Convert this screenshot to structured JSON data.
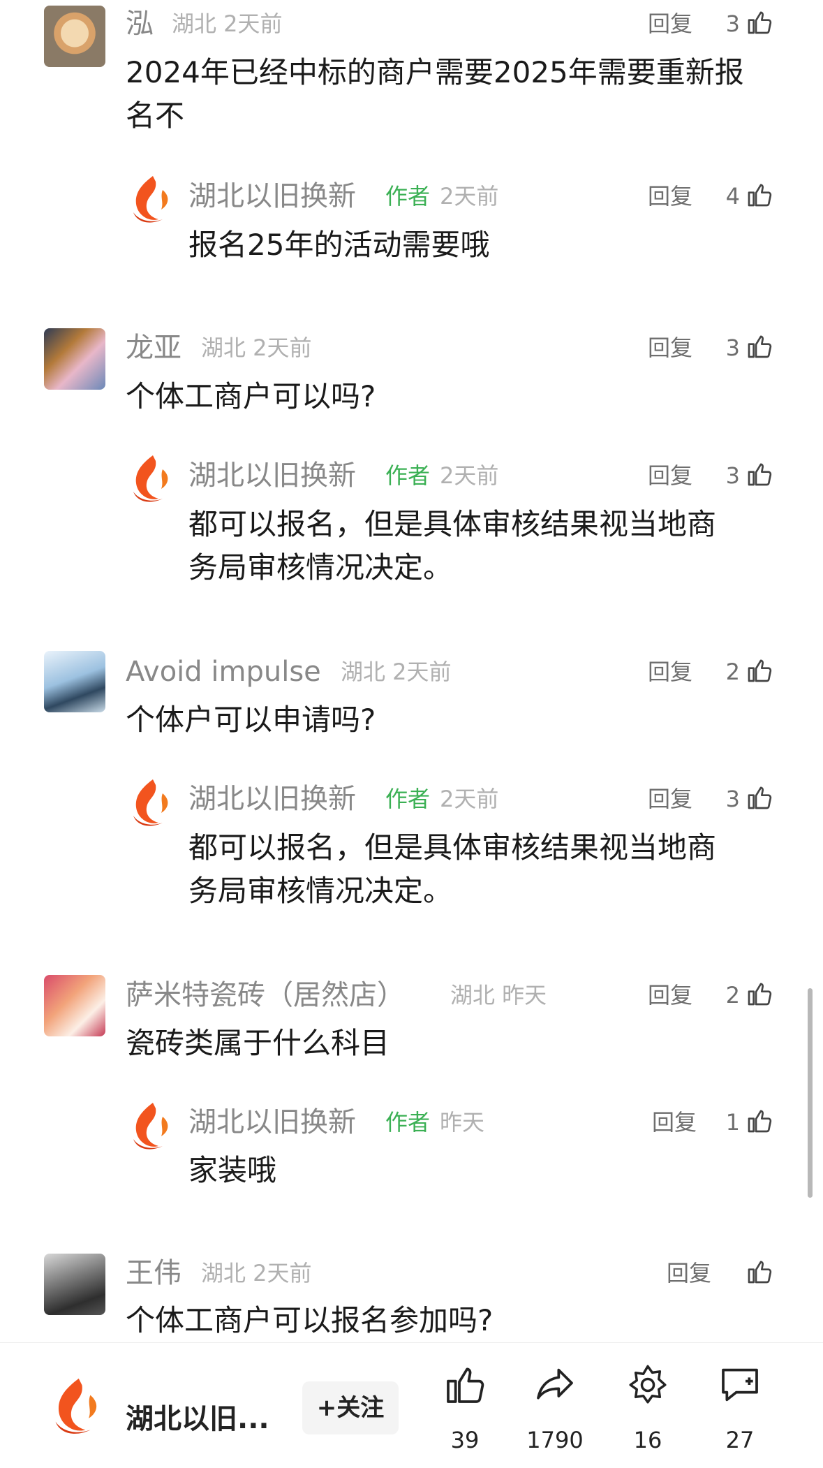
{
  "colors": {
    "author_green": "#3bb054",
    "meta_gray": "#b0b0b0",
    "name_gray": "#888888",
    "logo_orange": "#f2541e"
  },
  "reply_label": "回复",
  "comments": [
    {
      "name": "泓",
      "meta": "湖北 2天前",
      "likes": "3",
      "text_lines": [
        "2024年已经中标的商户需要2025年需要重新报",
        "名不"
      ],
      "reply": {
        "name": "湖北以旧换新",
        "tag": "作者",
        "meta": "2天前",
        "likes": "4",
        "text_lines": [
          "报名25年的活动需要哦"
        ]
      }
    },
    {
      "name": "龙亚",
      "meta": "湖北 2天前",
      "likes": "3",
      "text_lines": [
        "个体工商户可以吗?"
      ],
      "reply": {
        "name": "湖北以旧换新",
        "tag": "作者",
        "meta": "2天前",
        "likes": "3",
        "text_lines": [
          "都可以报名，但是具体审核结果视当地商",
          "务局审核情况决定。"
        ]
      }
    },
    {
      "name": "Avoid impulse",
      "meta": "湖北 2天前",
      "likes": "2",
      "text_lines": [
        "个体户可以申请吗?"
      ],
      "reply": {
        "name": "湖北以旧换新",
        "tag": "作者",
        "meta": "2天前",
        "likes": "3",
        "text_lines": [
          "都可以报名，但是具体审核结果视当地商",
          "务局审核情况决定。"
        ]
      }
    },
    {
      "name": "萨米特瓷砖（居然店）",
      "meta": "湖北 昨天",
      "likes": "2",
      "text_lines": [
        "瓷砖类属于什么科目"
      ],
      "reply": {
        "name": "湖北以旧换新",
        "tag": "作者",
        "meta": "昨天",
        "likes": "1",
        "text_lines": [
          "家装哦"
        ]
      }
    },
    {
      "name": "王伟",
      "meta": "湖北 2天前",
      "likes": "",
      "text_lines": [
        "个体工商户可以报名参加吗?"
      ]
    }
  ],
  "bottom_bar": {
    "account_name": "湖北以旧...",
    "follow_label": "+关注",
    "like_count": "39",
    "share_count": "1790",
    "favorite_count": "16",
    "comment_count": "27"
  }
}
